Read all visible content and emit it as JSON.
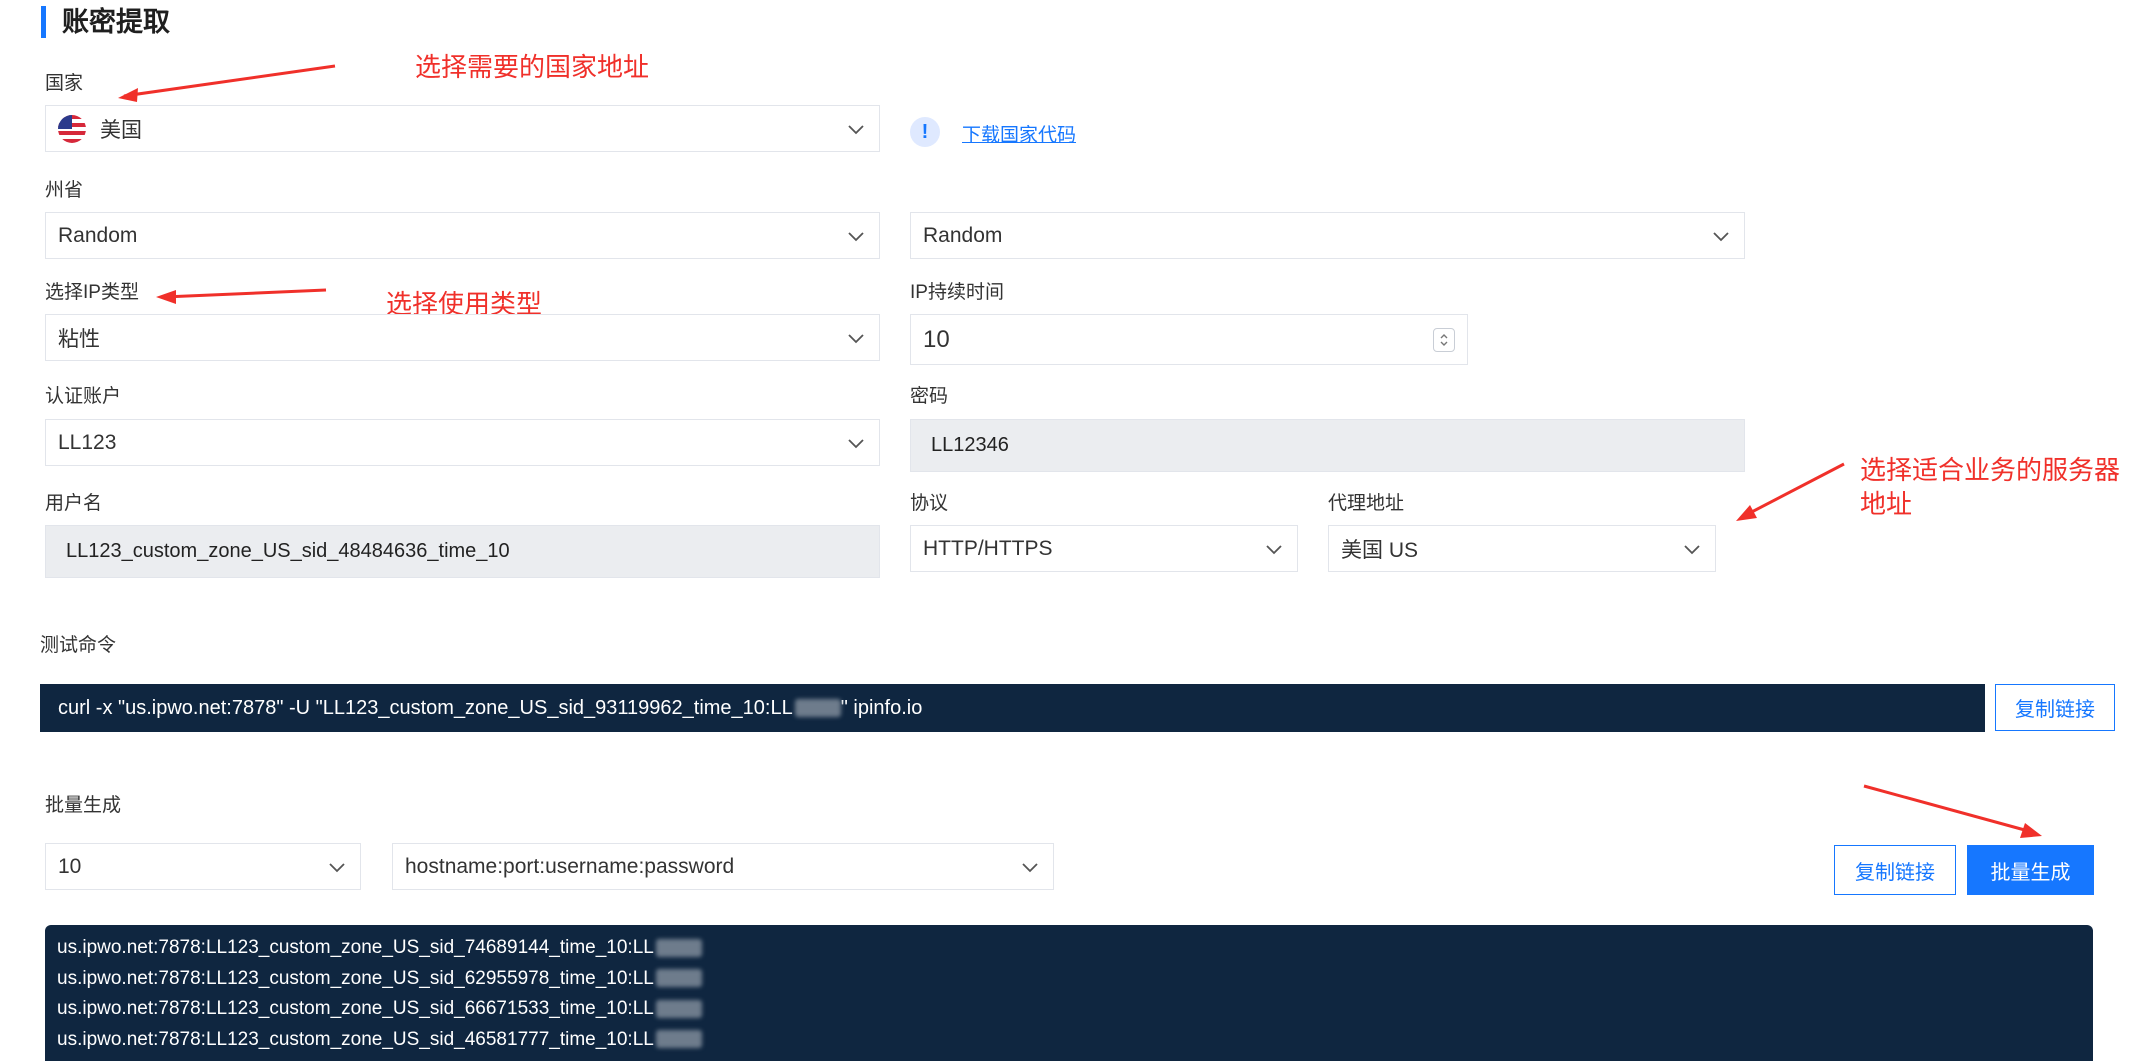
{
  "section_title": "账密提取",
  "annotations": {
    "country": "选择需要的国家地址",
    "ip_type": "选择使用类型",
    "server_line1": "选择适合业务的服务器",
    "server_line2": "地址"
  },
  "country": {
    "label": "国家",
    "value": "美国",
    "flag_icon": "us-flag-icon"
  },
  "download_link": "下载国家代码",
  "state": {
    "label": "州省",
    "value": "Random"
  },
  "city": {
    "value": "Random"
  },
  "ip_type": {
    "label": "选择IP类型",
    "value": "粘性"
  },
  "duration": {
    "label": "IP持续时间",
    "value": "10"
  },
  "auth_account": {
    "label": "认证账户",
    "value": "LL123"
  },
  "password": {
    "label": "密码",
    "value": "LL12346"
  },
  "username": {
    "label": "用户名",
    "value": "LL123_custom_zone_US_sid_48484636_time_10"
  },
  "protocol": {
    "label": "协议",
    "value": "HTTP/HTTPS"
  },
  "proxy": {
    "label": "代理地址",
    "value": "美国 US"
  },
  "test_command": {
    "label": "测试命令",
    "prefix": "curl -x \"us.ipwo.net:7878\" -U \"LL123_custom_zone_US_sid_93119962_time_10:LL",
    "suffix": "\" ipinfo.io",
    "copy_label": "复制链接"
  },
  "batch": {
    "label": "批量生成",
    "count": "10",
    "format": "hostname:port:username:password",
    "copy_label": "复制链接",
    "generate_label": "批量生成",
    "lines": [
      "us.ipwo.net:7878:LL123_custom_zone_US_sid_74689144_time_10:LL",
      "us.ipwo.net:7878:LL123_custom_zone_US_sid_62955978_time_10:LL",
      "us.ipwo.net:7878:LL123_custom_zone_US_sid_66671533_time_10:LL",
      "us.ipwo.net:7878:LL123_custom_zone_US_sid_46581777_time_10:LL"
    ]
  },
  "colors": {
    "accent": "#1677ff",
    "annotation": "#f0302a",
    "dark_panel": "#0f2640"
  }
}
